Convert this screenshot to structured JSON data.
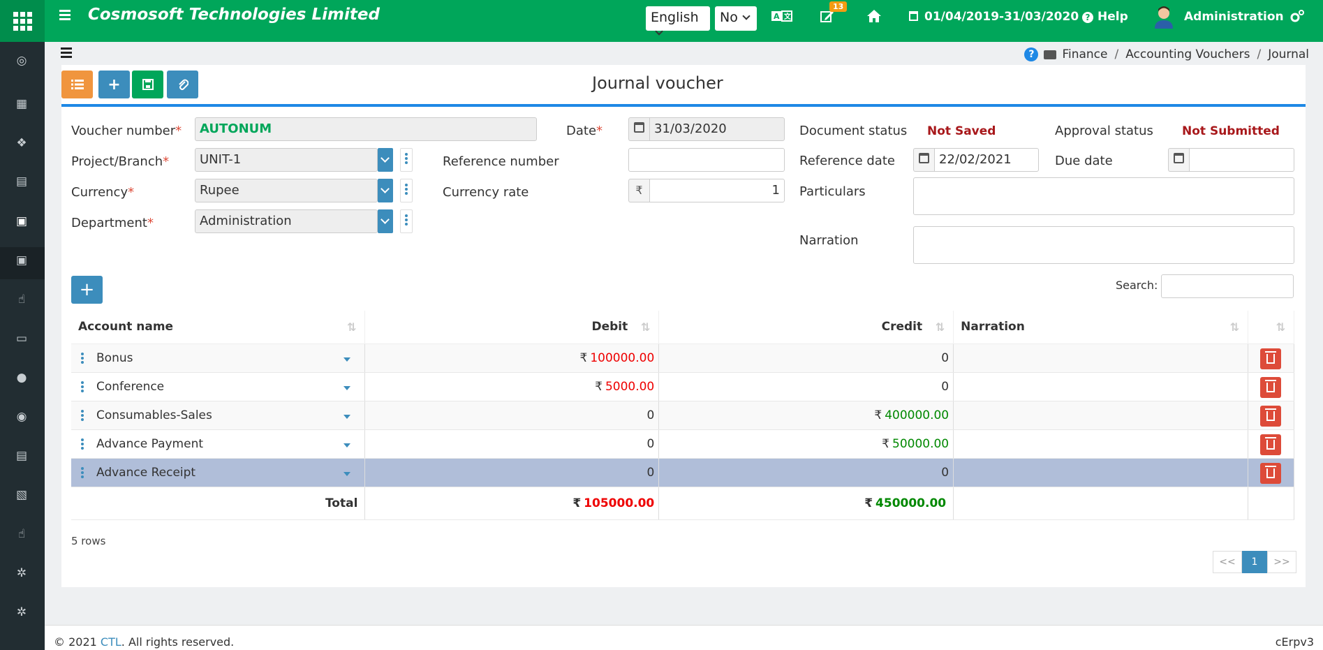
{
  "header": {
    "company": "Cosmosoft Technologies Limited",
    "language": "English",
    "option": "No",
    "badge_count": "13",
    "period": "01/04/2019-31/03/2020",
    "help": "Help",
    "user": "Administration",
    "brand_color": "#00a65a"
  },
  "breadcrumb": [
    "Finance",
    "Accounting Vouchers",
    "Journal"
  ],
  "page": {
    "title": "Journal voucher"
  },
  "form": {
    "voucher_number_label": "Voucher number",
    "voucher_number": "AUTONUM",
    "project_label": "Project/Branch",
    "project": "UNIT-1",
    "currency_label": "Currency",
    "currency": "Rupee",
    "department_label": "Department",
    "department": "Administration",
    "date_label": "Date",
    "date": "31/03/2020",
    "reference_number_label": "Reference number",
    "reference_number": "",
    "currency_rate_label": "Currency rate",
    "currency_symbol": "₹",
    "currency_rate": "1",
    "document_status_label": "Document status",
    "document_status": "Not Saved",
    "approval_status_label": "Approval status",
    "approval_status": "Not Submitted",
    "reference_date_label": "Reference date",
    "reference_date": "22/02/2021",
    "due_date_label": "Due date",
    "due_date": "",
    "particulars_label": "Particulars",
    "narration_label": "Narration"
  },
  "table": {
    "search_label": "Search:",
    "headers": [
      "Account name",
      "Debit",
      "Credit",
      "Narration"
    ],
    "rows": [
      {
        "account": "Bonus",
        "debit": "100000.00",
        "credit": "0"
      },
      {
        "account": "Conference",
        "debit": "5000.00",
        "credit": "0"
      },
      {
        "account": "Consumables-Sales",
        "debit": "0",
        "credit": "400000.00"
      },
      {
        "account": "Advance Payment",
        "debit": "0",
        "credit": "50000.00"
      },
      {
        "account": "Advance Receipt",
        "debit": "0",
        "credit": "0"
      }
    ],
    "total_label": "Total",
    "total_debit": "105000.00",
    "total_credit": "450000.00",
    "rows_count": "5 rows",
    "pager": {
      "prev": "<<",
      "current": "1",
      "next": ">>"
    }
  },
  "footer": {
    "copyright": "© 2021",
    "company_link": "CTL",
    "rights": ". All rights reserved.",
    "version": "cErpv3"
  }
}
